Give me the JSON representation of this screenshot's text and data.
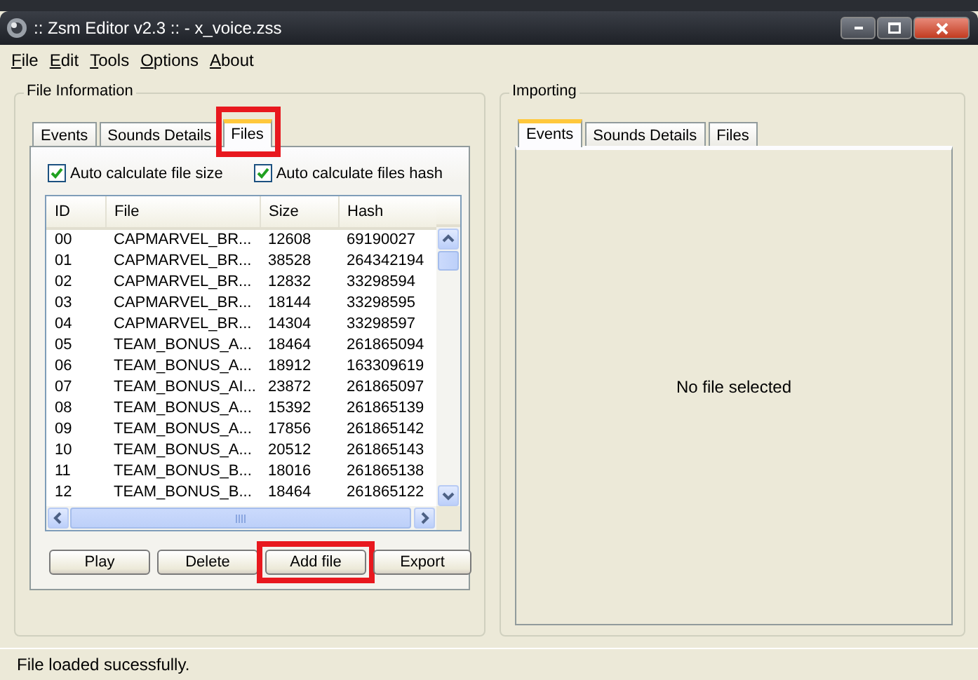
{
  "window": {
    "title": ":: Zsm Editor v2.3 :: - x_voice.zss"
  },
  "menu": [
    {
      "label": "File"
    },
    {
      "label": "Edit"
    },
    {
      "label": "Tools"
    },
    {
      "label": "Options"
    },
    {
      "label": "About"
    }
  ],
  "file_information": {
    "title": "File Information",
    "tabs": [
      {
        "label": "Events",
        "selected": false,
        "highlighted": false
      },
      {
        "label": "Sounds Details",
        "selected": false,
        "highlighted": false
      },
      {
        "label": "Files",
        "selected": true,
        "highlighted": true
      }
    ],
    "options": [
      {
        "label": "Auto calculate file size",
        "checked": true
      },
      {
        "label": "Auto calculate files hash",
        "checked": true
      }
    ],
    "table": {
      "columns": [
        "ID",
        "File",
        "Size",
        "Hash"
      ],
      "rows": [
        [
          "00",
          "CAPMARVEL_BR...",
          "12608",
          "69190027"
        ],
        [
          "01",
          "CAPMARVEL_BR...",
          "38528",
          "264342194"
        ],
        [
          "02",
          "CAPMARVEL_BR...",
          "12832",
          "33298594"
        ],
        [
          "03",
          "CAPMARVEL_BR...",
          "18144",
          "33298595"
        ],
        [
          "04",
          "CAPMARVEL_BR...",
          "14304",
          "33298597"
        ],
        [
          "05",
          "TEAM_BONUS_A...",
          "18464",
          "261865094"
        ],
        [
          "06",
          "TEAM_BONUS_A...",
          "18912",
          "163309619"
        ],
        [
          "07",
          "TEAM_BONUS_AI...",
          "23872",
          "261865097"
        ],
        [
          "08",
          "TEAM_BONUS_A...",
          "15392",
          "261865139"
        ],
        [
          "09",
          "TEAM_BONUS_A...",
          "17856",
          "261865142"
        ],
        [
          "10",
          "TEAM_BONUS_A...",
          "20512",
          "261865143"
        ],
        [
          "11",
          "TEAM_BONUS_B...",
          "18016",
          "261865138"
        ],
        [
          "12",
          "TEAM_BONUS_B...",
          "18464",
          "261865122"
        ]
      ]
    },
    "buttons": [
      {
        "label": "Play",
        "highlighted": false
      },
      {
        "label": "Delete",
        "highlighted": false
      },
      {
        "label": "Add file",
        "highlighted": true
      },
      {
        "label": "Export",
        "highlighted": false
      }
    ]
  },
  "importing": {
    "title": "Importing",
    "tabs": [
      {
        "label": "Events",
        "selected": true
      },
      {
        "label": "Sounds Details",
        "selected": false
      },
      {
        "label": "Files",
        "selected": false
      }
    ],
    "message": "No file selected"
  },
  "status_bar": "File loaded sucessfully."
}
